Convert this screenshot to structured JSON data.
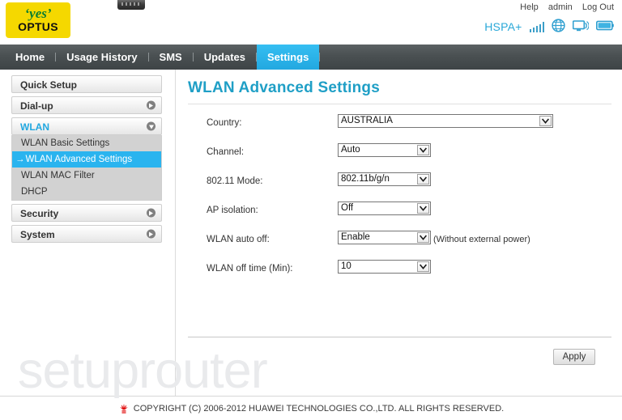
{
  "brand": {
    "logo_line1": "‘yes’",
    "logo_line2": "OPTUS",
    "logo_bg": "#f5d800",
    "logo_text_color": "#0a7d32"
  },
  "header": {
    "links": [
      {
        "label": "Help",
        "name": "help-link"
      },
      {
        "label": "admin",
        "name": "admin-link"
      },
      {
        "label": "Log Out",
        "name": "logout-link"
      }
    ],
    "status": {
      "network_type": "HSPA+",
      "signal_bars": 5,
      "icons": [
        "globe-icon",
        "wifi-monitor-icon",
        "battery-icon"
      ],
      "accent": "#2aa8d8"
    }
  },
  "nav": {
    "active": "Settings",
    "active_color": "#22a8e0",
    "tabs": [
      {
        "label": "Home",
        "active": false
      },
      {
        "label": "Usage History",
        "active": false
      },
      {
        "label": "SMS",
        "active": false
      },
      {
        "label": "Updates",
        "active": false
      },
      {
        "label": "Settings",
        "active": true
      }
    ]
  },
  "sidebar": {
    "groups": [
      {
        "label": "Quick Setup",
        "expandable": false,
        "open": false
      },
      {
        "label": "Dial-up",
        "expandable": true,
        "open": false
      },
      {
        "label": "WLAN",
        "expandable": true,
        "open": true,
        "items": [
          {
            "label": "WLAN Basic Settings",
            "active": false
          },
          {
            "label": "WLAN Advanced Settings",
            "active": true,
            "marker": "→"
          },
          {
            "label": "WLAN MAC Filter",
            "active": false
          },
          {
            "label": "DHCP",
            "active": false
          }
        ]
      },
      {
        "label": "Security",
        "expandable": true,
        "open": false
      },
      {
        "label": "System",
        "expandable": true,
        "open": false
      }
    ]
  },
  "main": {
    "title": "WLAN Advanced Settings",
    "title_color": "#1f9fc6",
    "fields": [
      {
        "label": "Country:",
        "value": "AUSTRALIA",
        "width": "wide",
        "note": ""
      },
      {
        "label": "Channel:",
        "value": "Auto",
        "width": "narrow",
        "note": ""
      },
      {
        "label": "802.11 Mode:",
        "value": "802.11b/g/n",
        "width": "narrow",
        "note": ""
      },
      {
        "label": "AP isolation:",
        "value": "Off",
        "width": "narrow",
        "note": ""
      },
      {
        "label": "WLAN auto off:",
        "value": "Enable",
        "width": "narrow",
        "note": "(Without external power)"
      },
      {
        "label": "WLAN off time (Min):",
        "value": "10",
        "width": "narrow",
        "note": ""
      }
    ],
    "apply_label": "Apply"
  },
  "watermark": "setuprouter",
  "footer": {
    "copyright": "COPYRIGHT (C) 2006-2012 HUAWEI TECHNOLOGIES CO.,LTD. ALL RIGHTS RESERVED.",
    "logo": "huawei-flower-logo"
  }
}
